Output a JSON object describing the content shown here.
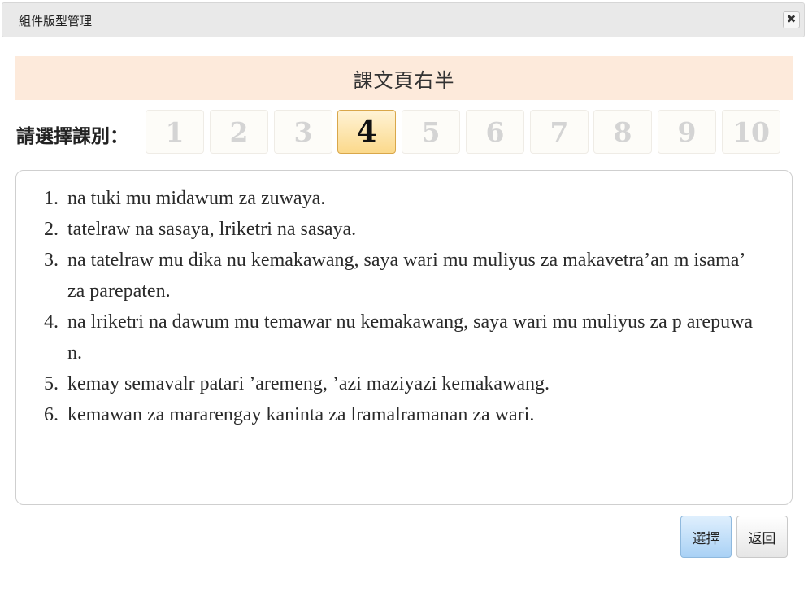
{
  "dialog": {
    "title": "組件版型管理",
    "close_label": "✖"
  },
  "heading": "課文頁右半",
  "lesson_selector": {
    "label": "請選擇課別：",
    "options": [
      "1",
      "2",
      "3",
      "4",
      "5",
      "6",
      "7",
      "8",
      "9",
      "10"
    ],
    "selected": "4"
  },
  "content": {
    "lines": [
      {
        "num": "1.",
        "text": "na tuki mu midawum za zuwaya."
      },
      {
        "num": "2.",
        "text": "tatelraw na sasaya, lriketri na sasaya."
      },
      {
        "num": "3.",
        "text": "na tatelraw mu dika nu kemakawang, saya wari mu muliyus za makavetra’an m isama’ za parepaten."
      },
      {
        "num": "4.",
        "text": "na lriketri na dawum mu temawar nu kemakawang, saya wari mu muliyus za p arepuwan."
      },
      {
        "num": "5.",
        "text": "kemay semavalr patari ’aremeng, ’azi maziyazi kemakawang."
      },
      {
        "num": "6.",
        "text": "kemawan za mararengay kaninta za lramalramanan za wari."
      }
    ]
  },
  "footer": {
    "select_label": "選擇",
    "back_label": "返回"
  },
  "colors": {
    "heading_band": "#fdeadb",
    "active_lesson": "#fbd98b",
    "select_button": "#a9d1f5"
  }
}
